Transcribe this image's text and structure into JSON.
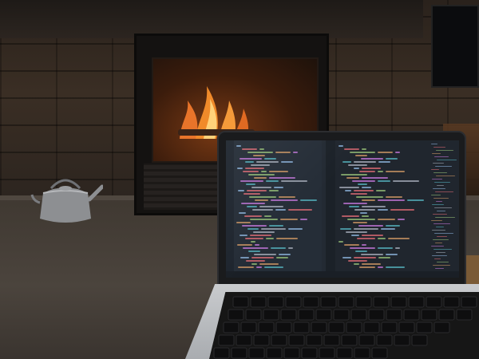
{
  "scene": {
    "subject": "laptop-in-front-of-fireplace",
    "colors": {
      "fire": "#f08a2a",
      "fire_core": "#ffd27a",
      "stone": "#3a2e24",
      "hearth": "#4b443d",
      "laptop_silver": "#c0c2c5",
      "editor_bg": "#232a33"
    },
    "icons": [
      "kettle-icon",
      "flame-icon",
      "laptop-icon",
      "tv-icon"
    ]
  },
  "laptop": {
    "screen": {
      "editor": "code-editor",
      "panes": 2
    }
  }
}
